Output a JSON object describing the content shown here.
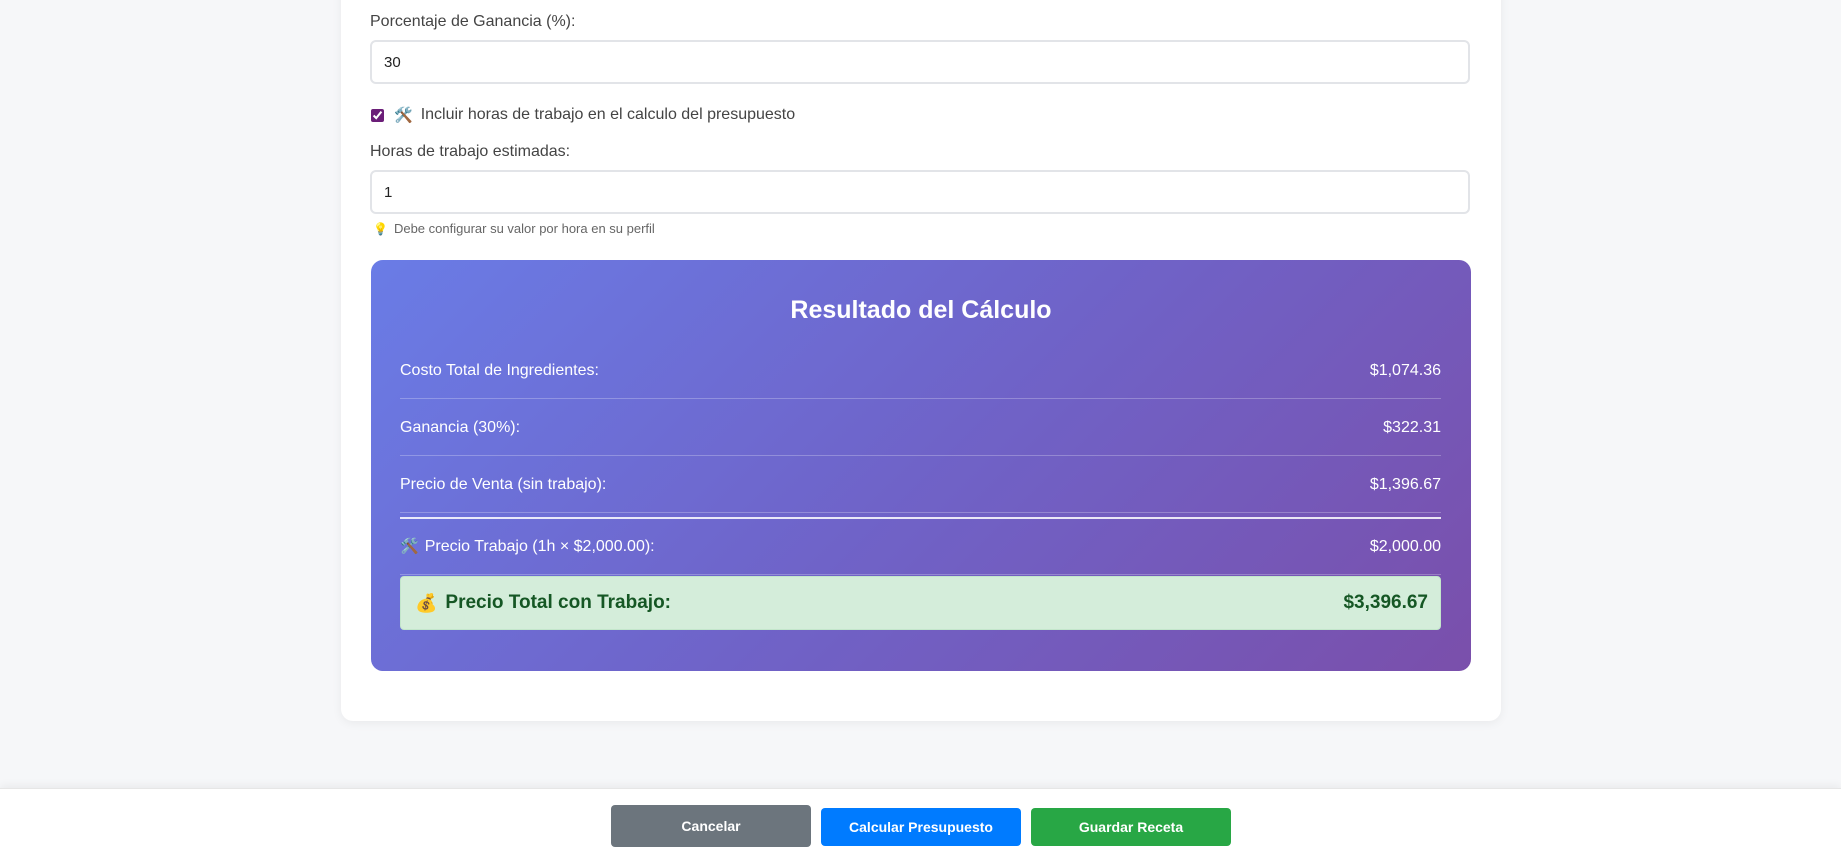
{
  "form": {
    "profit_label": "Porcentaje de Ganancia (%):",
    "profit_value": "30",
    "include_hours_label": "Incluir horas de trabajo en el calculo del presupuesto",
    "include_hours_checked": true,
    "hours_label": "Horas de trabajo estimadas:",
    "hours_value": "1",
    "hint_text": "Debe configurar su valor por hora en su perfil"
  },
  "result": {
    "title": "Resultado del Cálculo",
    "rows": [
      {
        "label": "Costo Total de Ingredientes:",
        "value": "$1,074.36"
      },
      {
        "label": "Ganancia (30%):",
        "value": "$322.31"
      },
      {
        "label": "Precio de Venta (sin trabajo):",
        "value": "$1,396.67"
      },
      {
        "label": "Precio Trabajo (1h × $2,000.00):",
        "value": "$2,000.00"
      }
    ],
    "total_label": "Precio Total con Trabajo:",
    "total_value": "$3,396.67"
  },
  "footer": {
    "cancel_label": "Cancelar",
    "calculate_label": "Calcular Presupuesto",
    "save_label": "Guardar Receta"
  },
  "icons": {
    "tools": "tools-icon",
    "lightbulb": "lightbulb-icon",
    "money_bag": "money-bag-icon"
  },
  "colors": {
    "cancel": "#6c757d",
    "primary": "#007bff",
    "success": "#28a745",
    "total_bg": "#d4edda",
    "total_text": "#155724",
    "gradient_start": "#6a7ce6",
    "gradient_end": "#7a4fab"
  }
}
